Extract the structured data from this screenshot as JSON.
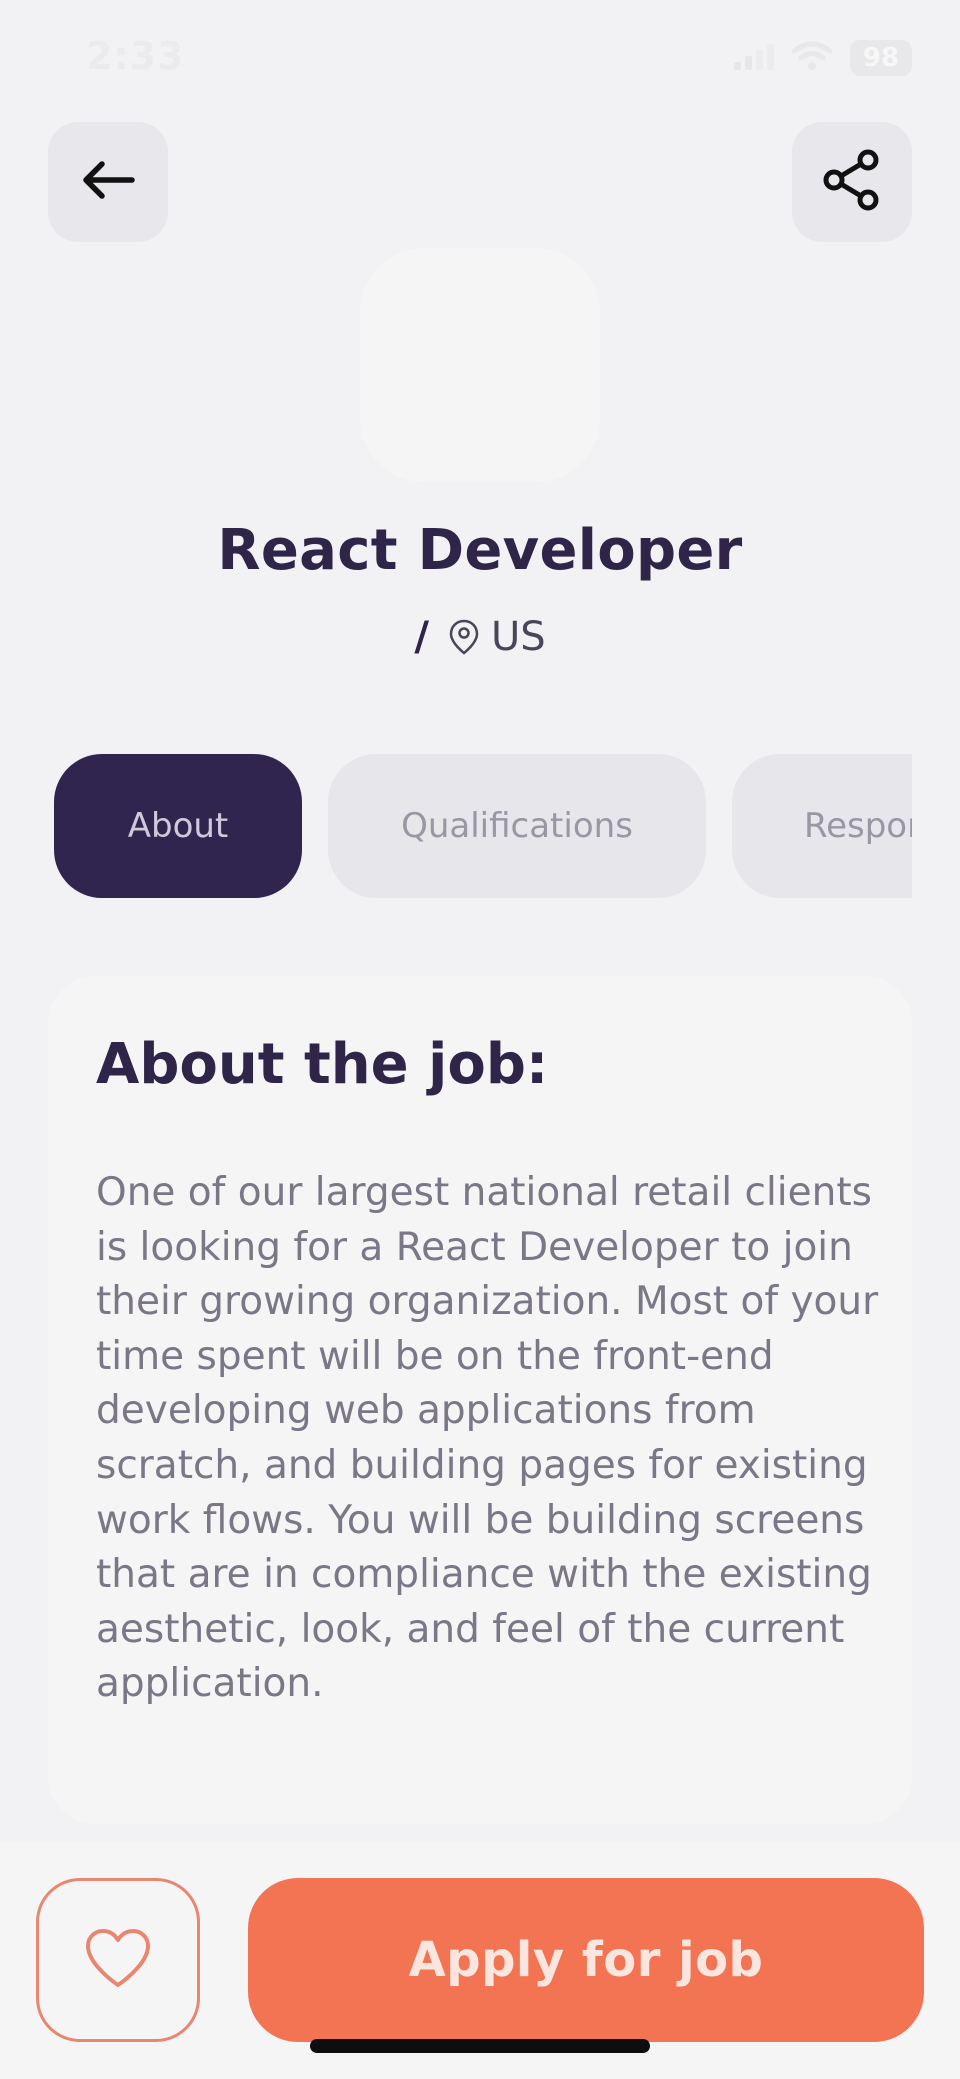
{
  "status_bar": {
    "time": "2:33",
    "battery": "98"
  },
  "header": {
    "back_icon": "arrow-left-icon",
    "share_icon": "share-icon"
  },
  "job": {
    "title": "React Developer",
    "separator": "/",
    "location_icon": "location-pin-icon",
    "location": "US"
  },
  "tabs": [
    {
      "label": "About",
      "active": true
    },
    {
      "label": "Qualifications",
      "active": false
    },
    {
      "label": "Respon",
      "active": false
    }
  ],
  "about": {
    "title": "About the job:",
    "body": "One of our largest national retail clients is looking for a React Developer to join their growing organization. Most of your time spent will be on the front-end developing web applications from scratch, and building pages for existing work flows. You will be building screens that are in compliance with the existing aesthetic, look, and feel of the current application."
  },
  "actions": {
    "favorite_icon": "heart-icon",
    "apply_label": "Apply for job"
  },
  "colors": {
    "background": "#f2f2f4",
    "primary_dark": "#30254e",
    "accent": "#f37453",
    "body_text": "#7b7787"
  }
}
